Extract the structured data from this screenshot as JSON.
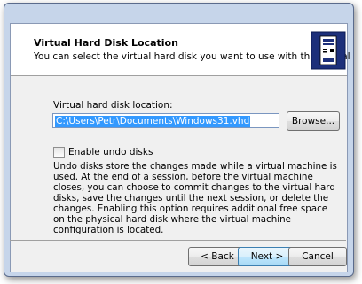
{
  "header": {
    "title": "Virtual Hard Disk Location",
    "subtitle": "You can select the virtual hard disk you want to use with this virtual machine."
  },
  "location": {
    "label": "Virtual hard disk location:",
    "value": "C:\\Users\\Petr\\Documents\\Windows31.vhd"
  },
  "browse_label": "Browse...",
  "undo": {
    "label": "Enable undo disks",
    "checked": false,
    "description": "Undo disks store the changes made while a virtual machine is used. At the end of a session, before the virtual machine closes, you can choose to commit changes to the virtual hard disks, save the changes until the next session, or delete the changes. Enabling this option requires additional free space on the physical hard disk where the virtual machine configuration is located."
  },
  "buttons": {
    "back": "< Back",
    "next": "Next >",
    "cancel": "Cancel"
  },
  "icons": {
    "wizard": "server-computer-icon"
  }
}
